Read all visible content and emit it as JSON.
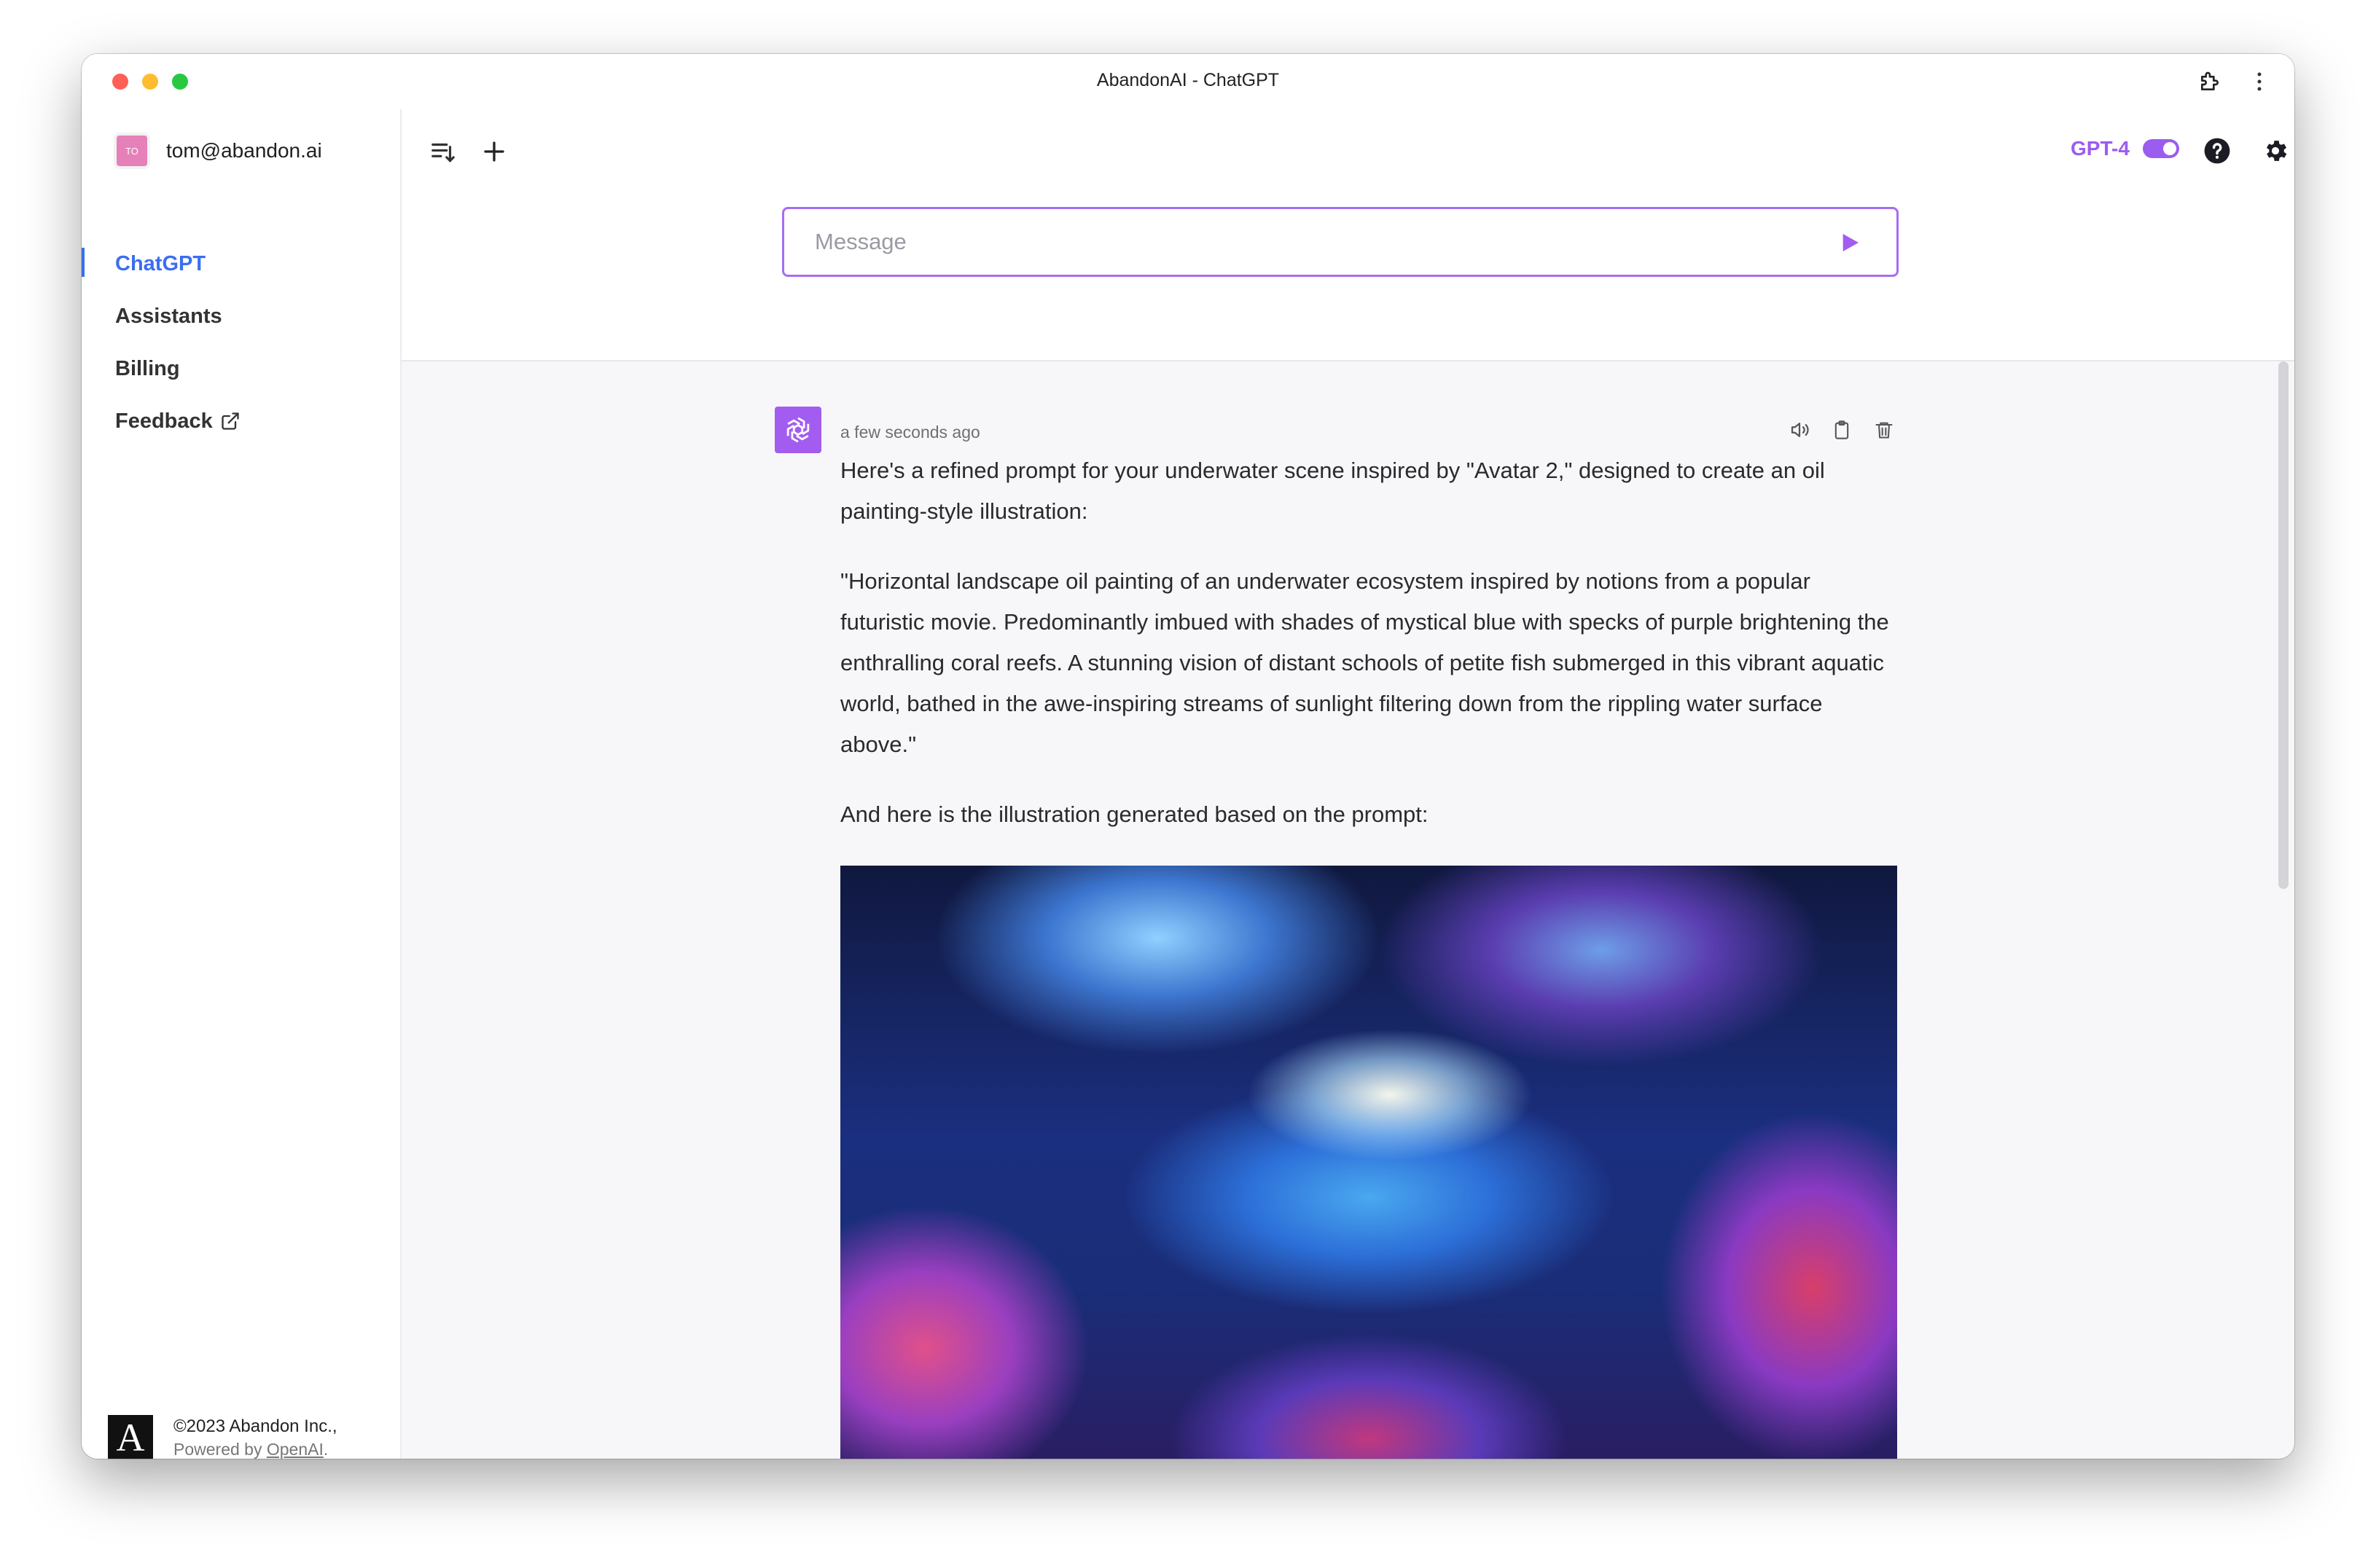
{
  "window": {
    "title": "AbandonAI - ChatGPT"
  },
  "user": {
    "avatar_initials": "TO",
    "email": "tom@abandon.ai"
  },
  "sidebar": {
    "items": [
      {
        "label": "ChatGPT",
        "active": true
      },
      {
        "label": "Assistants",
        "active": false
      },
      {
        "label": "Billing",
        "active": false
      },
      {
        "label": "Feedback",
        "active": false,
        "external": true
      }
    ],
    "footer": {
      "logo_letter": "A",
      "copyright": "©2023 Abandon Inc.,",
      "powered_prefix": "Powered by",
      "powered_link": "OpenAI",
      "powered_suffix": "."
    }
  },
  "header": {
    "model_label": "GPT-4",
    "model_toggle_on": true,
    "accent_color": "#9b5cf0",
    "active_nav_color": "#3b6ef0"
  },
  "composer": {
    "placeholder": "Message"
  },
  "messages": [
    {
      "role": "assistant",
      "time": "a few seconds ago",
      "paragraphs": [
        "Here's a refined prompt for your underwater scene inspired by \"Avatar 2,\" designed to create an oil painting-style illustration:",
        "\"Horizontal landscape oil painting of an underwater ecosystem inspired by notions from a popular futuristic movie. Predominantly imbued with shades of mystical blue with specks of purple brightening the enthralling coral reefs. A stunning vision of distant schools of petite fish submerged in this vibrant aquatic world, bathed in the awe-inspiring streams of sunlight filtering down from the rippling water surface above.\"",
        "And here is the illustration generated based on the prompt:"
      ],
      "actions": [
        "speaker-icon",
        "copy-icon",
        "trash-icon"
      ]
    }
  ]
}
